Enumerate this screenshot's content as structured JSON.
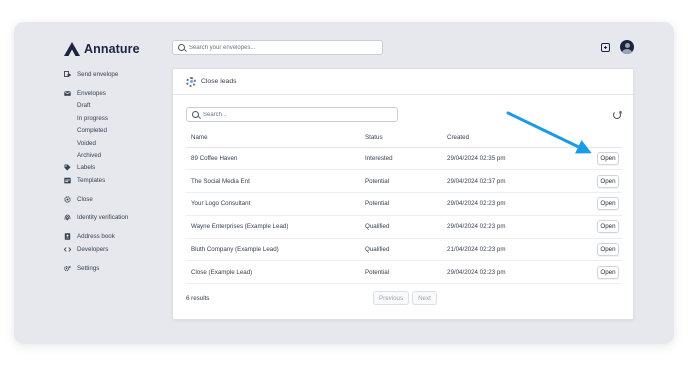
{
  "app": {
    "brand": "Annature"
  },
  "header": {
    "search_placeholder": "Search your envelopes..."
  },
  "sidebar": {
    "items": [
      {
        "label": "Send envelope",
        "icon": "send-icon"
      },
      {
        "label": "Envelopes",
        "icon": "envelope-icon"
      },
      {
        "label": "Labels",
        "icon": "tag-icon"
      },
      {
        "label": "Templates",
        "icon": "template-icon"
      },
      {
        "label": "Close",
        "icon": "close-gear-icon"
      },
      {
        "label": "Identity verification",
        "icon": "fingerprint-icon"
      },
      {
        "label": "Address book",
        "icon": "address-book-icon"
      },
      {
        "label": "Developers",
        "icon": "code-icon"
      },
      {
        "label": "Settings",
        "icon": "settings-icon"
      }
    ],
    "envelope_subitems": [
      "Draft",
      "In progress",
      "Completed",
      "Voided",
      "Archived"
    ]
  },
  "panel": {
    "title": "Close leads",
    "search_placeholder": "Search...",
    "columns": [
      "Name",
      "Status",
      "Created"
    ],
    "rows": [
      {
        "name": "89 Coffee Haven",
        "status": "Interested",
        "created": "29/04/2024 02:35 pm",
        "action": "Open"
      },
      {
        "name": "The Social Media Ent",
        "status": "Potential",
        "created": "29/04/2024 02:37 pm",
        "action": "Open"
      },
      {
        "name": "Your Logo Consultant",
        "status": "Potential",
        "created": "29/04/2024 02:23 pm",
        "action": "Open"
      },
      {
        "name": "Wayne Enterprises (Example Lead)",
        "status": "Qualified",
        "created": "29/04/2024 02:23 pm",
        "action": "Open"
      },
      {
        "name": "Bluth Company (Example Lead)",
        "status": "Qualified",
        "created": "21/04/2024 02:23 pm",
        "action": "Open"
      },
      {
        "name": "Close (Example Lead)",
        "status": "Potential",
        "created": "29/04/2024 02:23 pm",
        "action": "Open"
      }
    ],
    "results_text": "6 results",
    "pager": {
      "previous": "Previous",
      "next": "Next"
    }
  },
  "colors": {
    "frame_bg": "#e6e8ee",
    "brand_navy": "#1b2540",
    "annotation_arrow": "#1a9be6"
  }
}
